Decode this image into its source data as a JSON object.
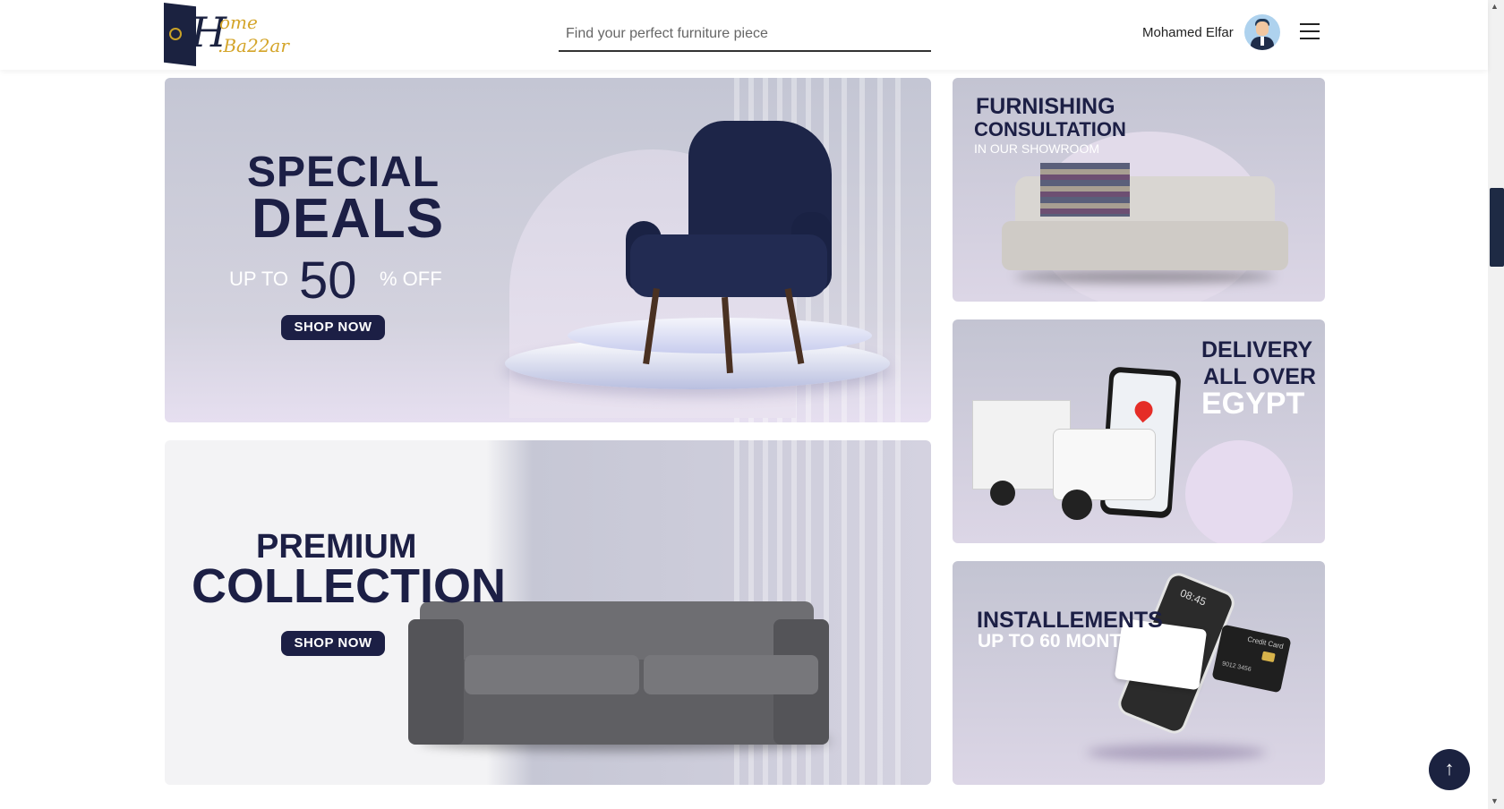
{
  "header": {
    "logo": {
      "home": "ome",
      "h": "H",
      "bazzar": ".Ba22ar"
    },
    "search_placeholder": "Find your perfect furniture piece",
    "user_name": "Mohamed Elfar"
  },
  "banners": {
    "special": {
      "line1": "SPECIAL",
      "line2": "DEALS",
      "up_to": "UP TO",
      "number": "50",
      "off": "% OFF",
      "button": "SHOP NOW"
    },
    "premium": {
      "line1": "PREMIUM",
      "line2": "COLLECTION",
      "button": "SHOP NOW"
    },
    "consultation": {
      "line1": "FURNISHING",
      "line2": "CONSULTATION",
      "line3": "IN OUR SHOWROOM"
    },
    "delivery": {
      "line1": "DELIVERY",
      "line2": "ALL OVER",
      "line3": "EGYPT"
    },
    "installments": {
      "line1": "INSTALLEMENTS",
      "line2": "UP TO 60 MONTHS",
      "phone_time": "08:45",
      "card_label": "Credit Card",
      "card_number": "9012 3456"
    }
  },
  "scroll_top_icon": "arrow-up-icon",
  "colors": {
    "navy": "#1c1f45",
    "accent_gold": "#d4a52a",
    "banner_bg": "#c6c7d5"
  }
}
